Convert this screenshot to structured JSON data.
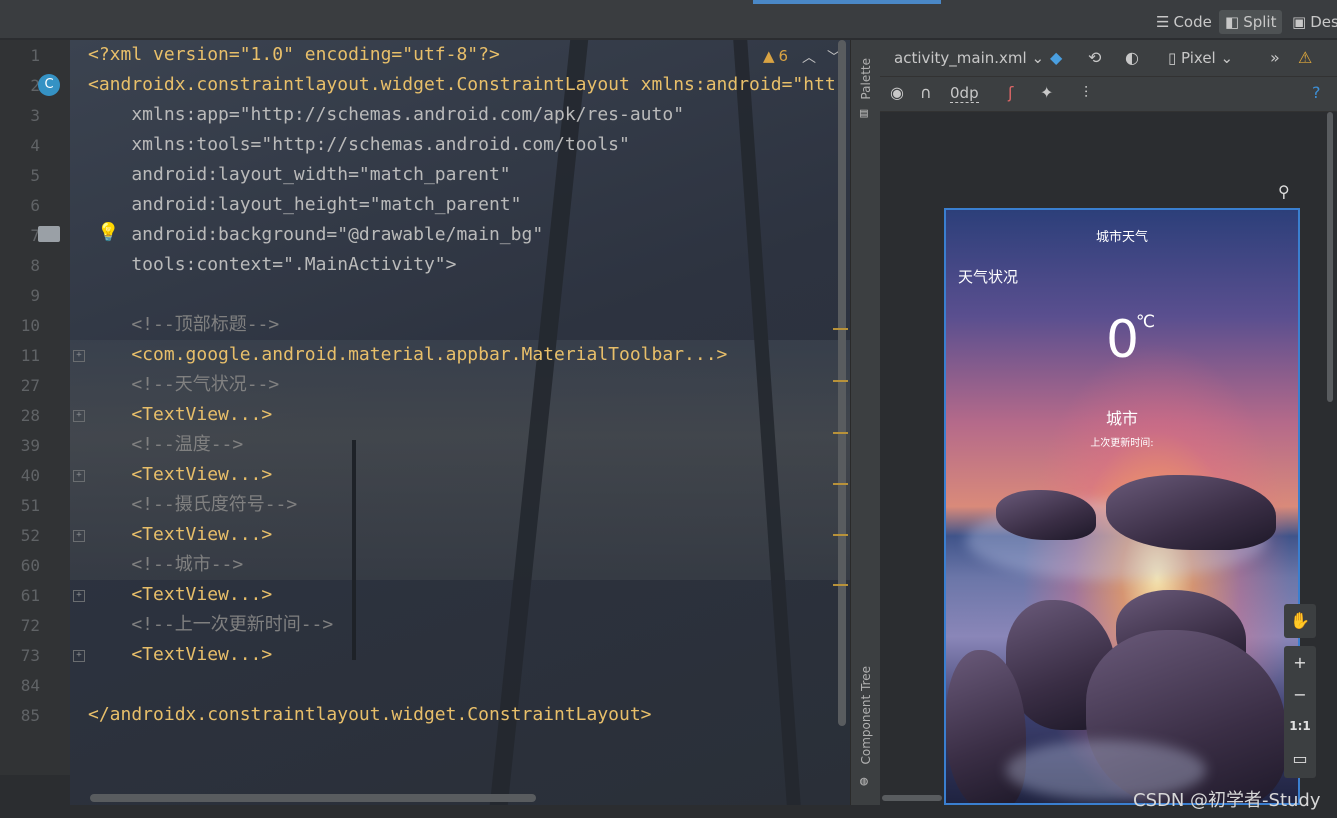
{
  "view_switcher": {
    "code_label": "Code",
    "split_label": "Split",
    "design_label": "Des"
  },
  "editor": {
    "warning_count": "6",
    "lines": [
      {
        "num": "1",
        "text": "<?xml version=\"1.0\" encoding=\"utf-8\"?>"
      },
      {
        "num": "2",
        "text": "<androidx.constraintlayout.widget.ConstraintLayout xmlns:android=\"htt"
      },
      {
        "num": "3",
        "text": "    xmlns:app=\"http://schemas.android.com/apk/res-auto\""
      },
      {
        "num": "4",
        "text": "    xmlns:tools=\"http://schemas.android.com/tools\""
      },
      {
        "num": "5",
        "text": "    android:layout_width=\"match_parent\""
      },
      {
        "num": "6",
        "text": "    android:layout_height=\"match_parent\""
      },
      {
        "num": "7",
        "text": "    android:background=\"@drawable/main_bg\""
      },
      {
        "num": "8",
        "text": "    tools:context=\".MainActivity\">"
      },
      {
        "num": "9",
        "text": ""
      },
      {
        "num": "10",
        "text": "    <!--顶部标题-->"
      },
      {
        "num": "11",
        "text": "    <com.google.android.material.appbar.MaterialToolbar...>"
      },
      {
        "num": "27",
        "text": "    <!--天气状况-->"
      },
      {
        "num": "28",
        "text": "    <TextView...>"
      },
      {
        "num": "39",
        "text": "    <!--温度-->"
      },
      {
        "num": "40",
        "text": "    <TextView...>"
      },
      {
        "num": "51",
        "text": "    <!--摄氏度符号-->"
      },
      {
        "num": "52",
        "text": "    <TextView...>"
      },
      {
        "num": "60",
        "text": "    <!--城市-->"
      },
      {
        "num": "61",
        "text": "    <TextView...>"
      },
      {
        "num": "72",
        "text": "    <!--上一次更新时间-->"
      },
      {
        "num": "73",
        "text": "    <TextView...>"
      },
      {
        "num": "84",
        "text": ""
      },
      {
        "num": "85",
        "text": "</androidx.constraintlayout.widget.ConstraintLayout>"
      }
    ]
  },
  "sidebar": {
    "palette_label": "Palette",
    "component_tree_label": "Component Tree"
  },
  "design_toolbar": {
    "file_name": "activity_main.xml",
    "device": "Pixel",
    "margin": "0dp"
  },
  "preview": {
    "toolbar_title": "城市天气",
    "weather_status": "天气状况",
    "temperature": "0",
    "degree_symbol": "℃",
    "city": "城市",
    "last_update": "上次更新时间:"
  },
  "zoom_tools": {
    "zoom_in": "+",
    "zoom_out": "−",
    "actual_size": "1:1"
  },
  "watermark": "CSDN @初学者-Study"
}
